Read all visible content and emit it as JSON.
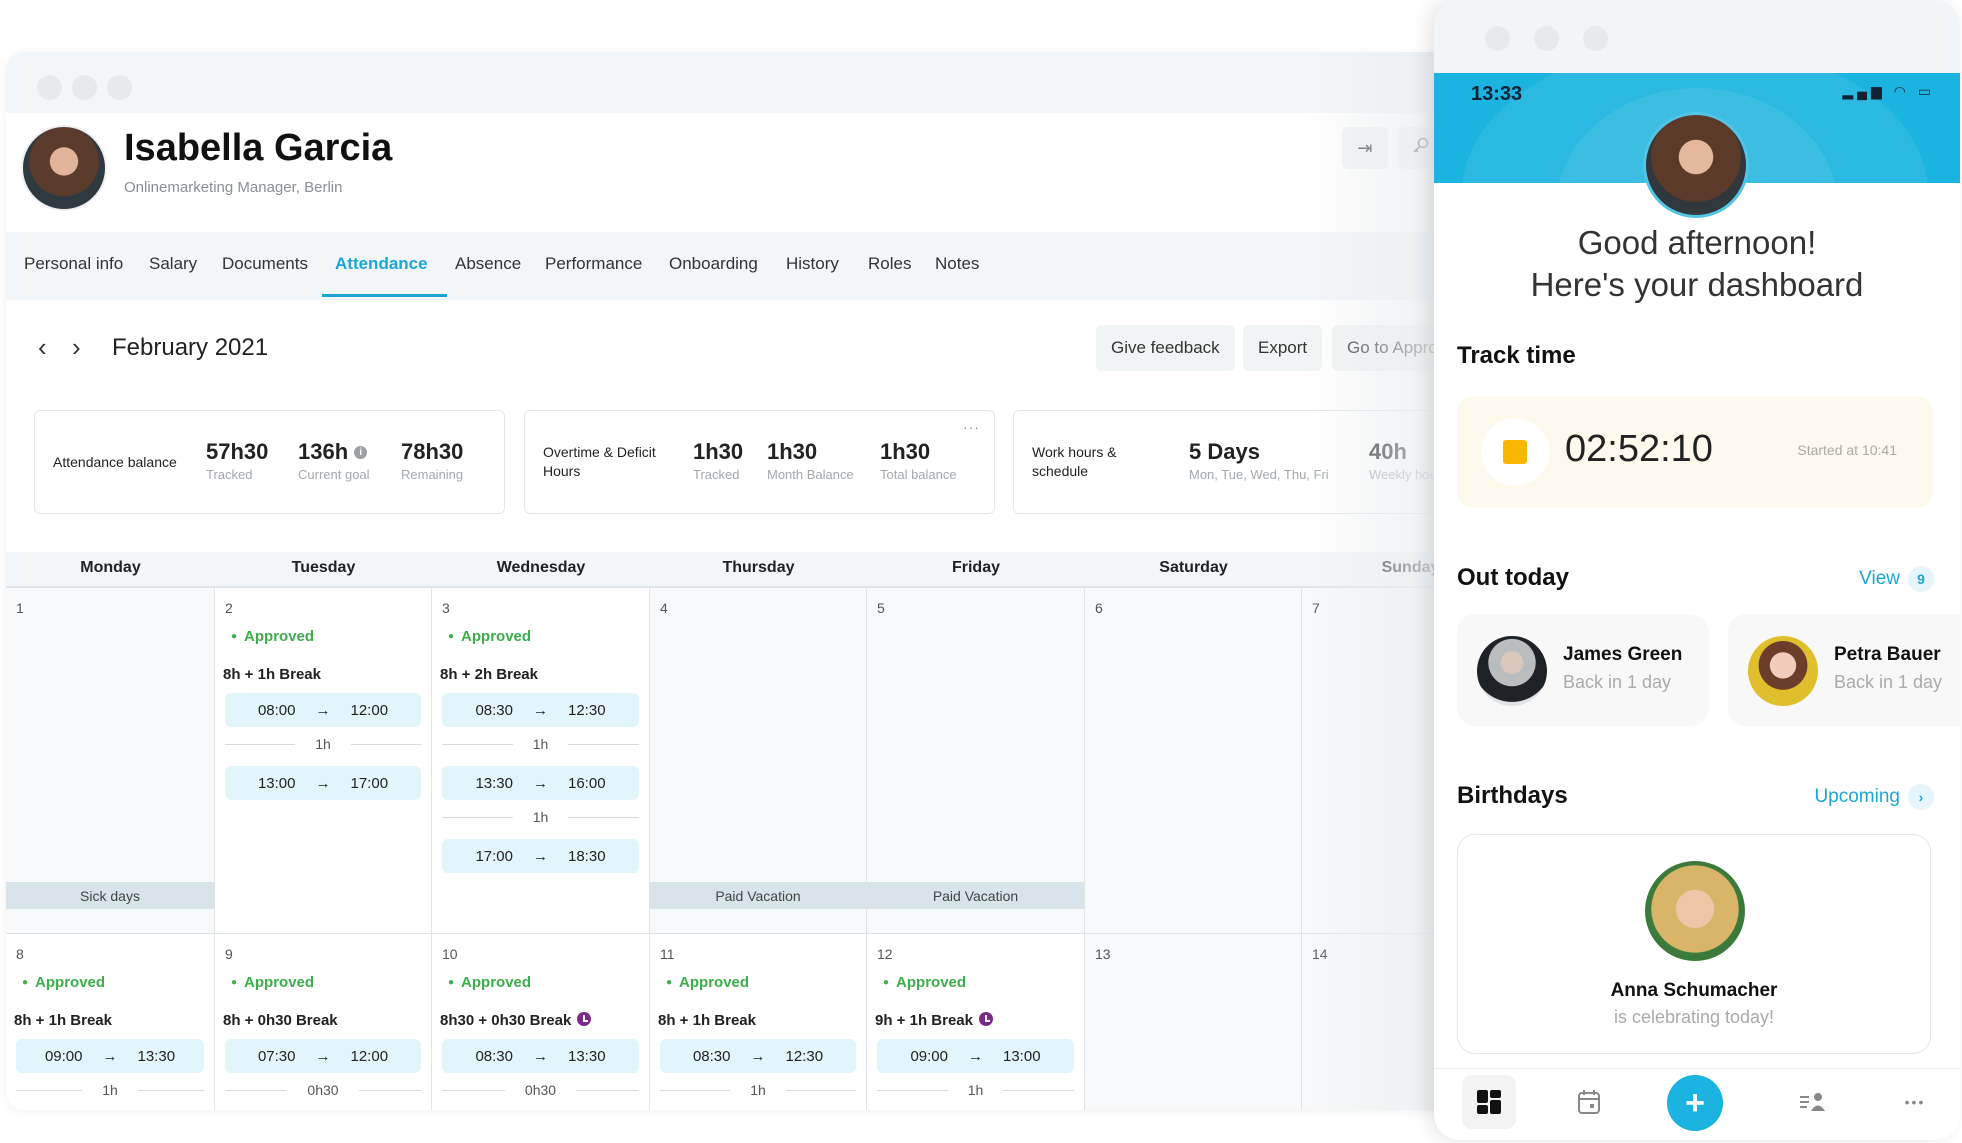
{
  "profile": {
    "name": "Isabella Garcia",
    "subtitle": "Onlinemarketing Manager, Berlin"
  },
  "header_actions": [
    {
      "icon": "sign-in-icon",
      "glyph": "⇥"
    },
    {
      "icon": "key-icon",
      "glyph": "⚿"
    }
  ],
  "tabs": [
    {
      "label": "Personal info",
      "active": false
    },
    {
      "label": "Salary",
      "active": false
    },
    {
      "label": "Documents",
      "active": false
    },
    {
      "label": "Attendance",
      "active": true
    },
    {
      "label": "Absence",
      "active": false
    },
    {
      "label": "Performance",
      "active": false
    },
    {
      "label": "Onboarding",
      "active": false
    },
    {
      "label": "History",
      "active": false
    },
    {
      "label": "Roles",
      "active": false
    },
    {
      "label": "Notes",
      "active": false
    }
  ],
  "month_nav": {
    "prev_glyph": "‹",
    "next_glyph": "›",
    "month": "February 2021"
  },
  "actions": {
    "give_feedback": "Give feedback",
    "export": "Export",
    "go_to_approvals": "Go to Appro"
  },
  "cards": {
    "attendance": {
      "label": "Attendance balance",
      "stats": [
        {
          "value": "57h30",
          "sub": "Tracked"
        },
        {
          "value": "136h",
          "sub": "Current goal",
          "info": "i"
        },
        {
          "value": "78h30",
          "sub": "Remaining"
        }
      ]
    },
    "overtime": {
      "label_line1": "Overtime & Deficit",
      "label_line2": "Hours",
      "more": "···",
      "stats": [
        {
          "value": "1h30",
          "sub": "Tracked"
        },
        {
          "value": "1h30",
          "sub": "Month Balance"
        },
        {
          "value": "1h30",
          "sub": "Total balance"
        }
      ]
    },
    "work_hours": {
      "label_line1": "Work hours &",
      "label_line2": "schedule",
      "stats": [
        {
          "value": "5 Days",
          "sub": "Mon, Tue, Wed, Thu, Fri"
        },
        {
          "value": "40h",
          "sub": "Weekly hour"
        }
      ]
    }
  },
  "calendar": {
    "days": [
      "Monday",
      "Tuesday",
      "Wednesday",
      "Thursday",
      "Friday",
      "Saturday",
      "Sunday"
    ],
    "arrow": "→",
    "week1": [
      {
        "num": "1",
        "band": "Sick days"
      },
      {
        "num": "2",
        "status": "Approved",
        "break": "8h + 1h Break",
        "pills": [
          [
            "08:00",
            "12:00"
          ],
          [
            "13:00",
            "17:00"
          ]
        ],
        "gaps": [
          "1h"
        ]
      },
      {
        "num": "3",
        "status": "Approved",
        "break": "8h + 2h Break",
        "pills": [
          [
            "08:30",
            "12:30"
          ],
          [
            "13:30",
            "16:00"
          ],
          [
            "17:00",
            "18:30"
          ]
        ],
        "gaps": [
          "1h",
          "1h"
        ]
      },
      {
        "num": "4",
        "band": "Paid Vacation"
      },
      {
        "num": "5",
        "band": "Paid Vacation"
      },
      {
        "num": "6"
      },
      {
        "num": "7"
      }
    ],
    "week2": [
      {
        "num": "8",
        "status": "Approved",
        "break": "8h + 1h Break",
        "pills": [
          [
            "09:00",
            "13:30"
          ]
        ],
        "gaps": [
          "1h"
        ]
      },
      {
        "num": "9",
        "status": "Approved",
        "break": "8h + 0h30 Break",
        "pills": [
          [
            "07:30",
            "12:00"
          ]
        ],
        "gaps": [
          "0h30"
        ]
      },
      {
        "num": "10",
        "status": "Approved",
        "break": "8h30 + 0h30 Break",
        "clock": true,
        "pills": [
          [
            "08:30",
            "13:30"
          ]
        ],
        "gaps": [
          "0h30"
        ]
      },
      {
        "num": "11",
        "status": "Approved",
        "break": "8h + 1h Break",
        "pills": [
          [
            "08:30",
            "12:30"
          ]
        ],
        "gaps": [
          "1h"
        ]
      },
      {
        "num": "12",
        "status": "Approved",
        "break": "9h + 1h Break",
        "clock": true,
        "pills": [
          [
            "09:00",
            "13:00"
          ]
        ],
        "gaps": [
          "1h"
        ]
      },
      {
        "num": "13"
      },
      {
        "num": "14"
      }
    ]
  },
  "phone": {
    "time": "13:33",
    "status_icons": "▂▄▆ ◠ ▭",
    "greeting_line1": "Good afternoon!",
    "greeting_line2": "Here's your dashboard",
    "track_time": {
      "title": "Track time",
      "timer": "02:52:10",
      "started": "Started at 10:41"
    },
    "out_today": {
      "title": "Out today",
      "link": "View",
      "count": "9",
      "people": [
        {
          "name": "James Green",
          "sub": "Back in 1 day"
        },
        {
          "name": "Petra Bauer",
          "sub": "Back in 1 day"
        }
      ]
    },
    "birthdays": {
      "title": "Birthdays",
      "link": "Upcoming",
      "chevron": "›",
      "name": "Anna Schumacher",
      "sub": "is celebrating today!"
    },
    "tabbar": {
      "add_glyph": "+",
      "more_glyph": "•••"
    }
  },
  "colors": {
    "accent": "#1aa7d6",
    "approved": "#3bb04a",
    "pill": "#e2f5fb",
    "band": "#d9e3ea",
    "clock": "#7b2a8c",
    "timer_stop": "#f8b800",
    "phone_header": "#1bb3df"
  }
}
